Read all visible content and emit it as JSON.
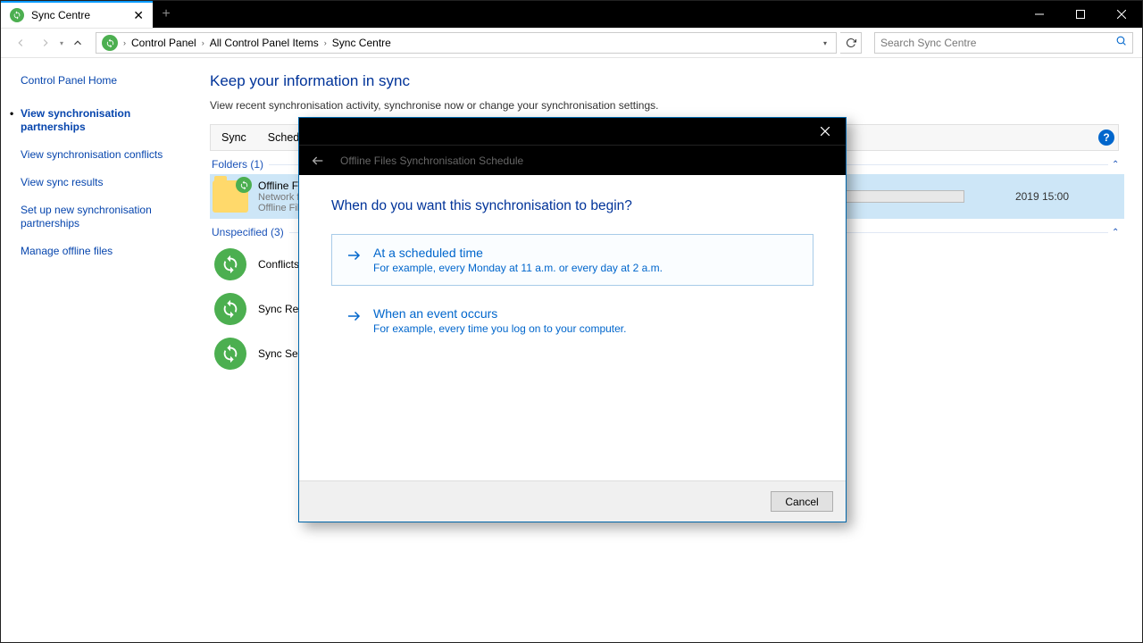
{
  "tab": {
    "title": "Sync Centre"
  },
  "breadcrumbs": [
    "Control Panel",
    "All Control Panel Items",
    "Sync Centre"
  ],
  "search": {
    "placeholder": "Search Sync Centre"
  },
  "sidebar": {
    "items": [
      {
        "label": "Control Panel Home",
        "active": false
      },
      {
        "label": "View synchronisation partnerships",
        "active": true
      },
      {
        "label": "View synchronisation conflicts",
        "active": false
      },
      {
        "label": "View sync results",
        "active": false
      },
      {
        "label": "Set up new synchronisation partnerships",
        "active": false
      },
      {
        "label": "Manage offline files",
        "active": false
      }
    ]
  },
  "page": {
    "heading": "Keep your information in sync",
    "subtitle": "View recent synchronisation activity, synchronise now or change your synchronisation settings."
  },
  "toolbar": {
    "sync": "Sync",
    "schedule": "Schedule"
  },
  "sections": {
    "folders": {
      "label": "Folders (1)"
    },
    "unspecified": {
      "label": "Unspecified (3)"
    }
  },
  "folders_item": {
    "title": "Offline Files",
    "sub1": "Network files available offline",
    "sub2": "Offline Files allows you to acce",
    "right_date": "2019 15:00"
  },
  "unspecified_items": [
    {
      "title": "Conflicts"
    },
    {
      "title": "Sync Results"
    },
    {
      "title": "Sync Setup"
    }
  ],
  "dialog": {
    "header_title": "Offline Files Synchronisation Schedule",
    "heading": "When do you want this synchronisation to begin?",
    "option1_title": "At a scheduled time",
    "option1_sub": "For example, every Monday at 11 a.m. or every day at 2 a.m.",
    "option2_title": "When an event occurs",
    "option2_sub": "For example, every time you log on to your computer.",
    "cancel": "Cancel"
  }
}
